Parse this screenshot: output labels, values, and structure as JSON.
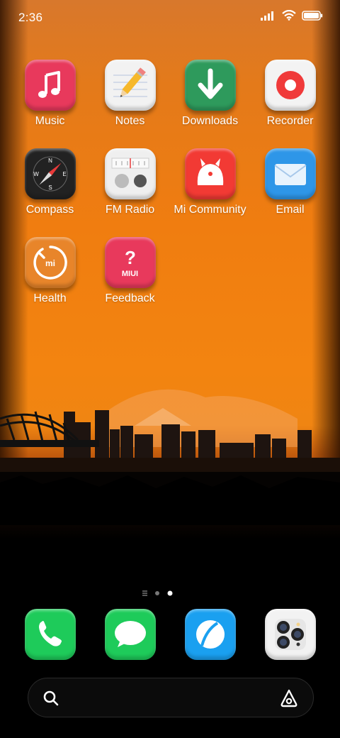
{
  "status_bar": {
    "time": "2:36",
    "icons": [
      "signal-icon",
      "wifi-icon",
      "battery-icon"
    ]
  },
  "apps": [
    {
      "label": "Music",
      "icon": "music-note-icon",
      "color": "#e8395c"
    },
    {
      "label": "Notes",
      "icon": "pencil-icon",
      "color": "#f2f2f2"
    },
    {
      "label": "Downloads",
      "icon": "download-arrow-icon",
      "color": "#2e9a5c"
    },
    {
      "label": "Recorder",
      "icon": "record-icon",
      "color": "#f3f3f3"
    },
    {
      "label": "Compass",
      "icon": "compass-icon",
      "color": "#222222"
    },
    {
      "label": "FM Radio",
      "icon": "radio-icon",
      "color": "#efefef"
    },
    {
      "label": "Mi Community",
      "icon": "mi-bunny-icon",
      "color": "#f23a34"
    },
    {
      "label": "Email",
      "icon": "envelope-icon",
      "color": "#2e96e8"
    },
    {
      "label": "Health",
      "icon": "mi-health-icon",
      "color": "#e8852a"
    },
    {
      "label": "Feedback",
      "icon": "question-mark-icon",
      "color": "#e8395c",
      "badge": "MIUI"
    }
  ],
  "page_indicator": {
    "pages": 3,
    "current": 3
  },
  "dock": [
    {
      "name": "phone",
      "icon": "phone-icon",
      "color": "#1ecb5a"
    },
    {
      "name": "messages",
      "icon": "chat-bubble-icon",
      "color": "#1ecb5a"
    },
    {
      "name": "browser",
      "icon": "browser-icon",
      "color": "#1aa0f0"
    },
    {
      "name": "camera",
      "icon": "camera-icon",
      "color": "#f2f2f2"
    }
  ],
  "search": {
    "icon": "search-icon",
    "assistant_icon": "assistant-icon"
  }
}
